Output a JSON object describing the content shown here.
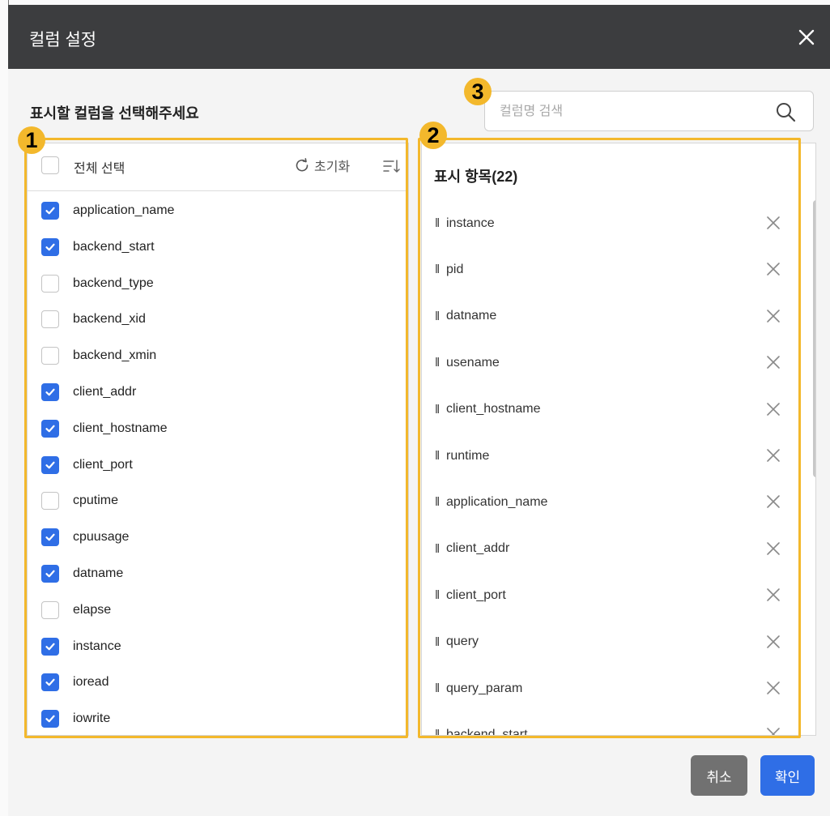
{
  "dialog": {
    "title": "컬럼 설정",
    "subtitle": "표시할 컬럼을 선택해주세요"
  },
  "annotations": [
    "1",
    "2",
    "3"
  ],
  "search": {
    "placeholder": "컬럼명 검색",
    "value": ""
  },
  "left_panel": {
    "select_all_label": "전체 선택",
    "select_all_checked": false,
    "reset_label": "초기화",
    "items": [
      {
        "label": "application_name",
        "checked": true
      },
      {
        "label": "backend_start",
        "checked": true
      },
      {
        "label": "backend_type",
        "checked": false
      },
      {
        "label": "backend_xid",
        "checked": false
      },
      {
        "label": "backend_xmin",
        "checked": false
      },
      {
        "label": "client_addr",
        "checked": true
      },
      {
        "label": "client_hostname",
        "checked": true
      },
      {
        "label": "client_port",
        "checked": true
      },
      {
        "label": "cputime",
        "checked": false
      },
      {
        "label": "cpuusage",
        "checked": true
      },
      {
        "label": "datname",
        "checked": true
      },
      {
        "label": "elapse",
        "checked": false
      },
      {
        "label": "instance",
        "checked": true
      },
      {
        "label": "ioread",
        "checked": true
      },
      {
        "label": "iowrite",
        "checked": true
      }
    ]
  },
  "right_panel": {
    "title": "표시 항목(22)",
    "grip_glyph": "‖",
    "items": [
      "instance",
      "pid",
      "datname",
      "usename",
      "client_hostname",
      "runtime",
      "application_name",
      "client_addr",
      "client_port",
      "query",
      "query_param",
      "backend_start"
    ]
  },
  "footer": {
    "cancel_label": "취소",
    "ok_label": "확인"
  },
  "colors": {
    "header_bg": "#3c3d3f",
    "highlight": "#f3b82c",
    "primary": "#2f6ee6",
    "cancel": "#717171"
  },
  "icons": [
    "close-icon",
    "refresh-icon",
    "sort-icon",
    "search-icon",
    "check-icon",
    "remove-icon",
    "drag-handle-icon"
  ]
}
